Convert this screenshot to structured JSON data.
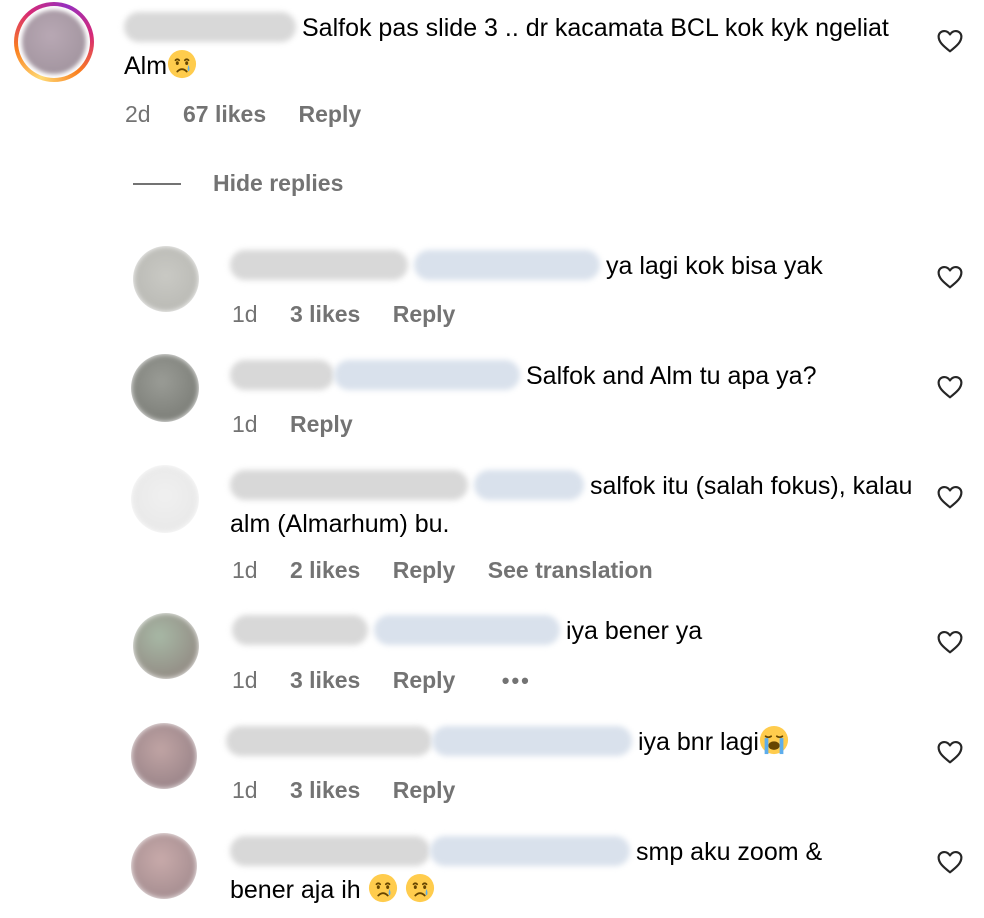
{
  "comments": {
    "main": {
      "text": "Salfok pas slide 3 .. dr kacamata BCL kok kyk ngeliat Alm",
      "time": "2d",
      "likes": "67 likes",
      "reply": "Reply",
      "emoji": "crying-face"
    },
    "hide_replies": "Hide replies",
    "replies": [
      {
        "text": "ya lagi kok bisa yak",
        "time": "1d",
        "likes": "3 likes",
        "reply": "Reply"
      },
      {
        "text": "Salfok and Alm tu apa ya?",
        "time": "1d",
        "reply": "Reply"
      },
      {
        "text": "salfok itu (salah fokus), kalau alm (Almarhum) bu.",
        "time": "1d",
        "likes": "2 likes",
        "reply": "Reply",
        "translation": "See translation"
      },
      {
        "text": "iya bener ya",
        "time": "1d",
        "likes": "3 likes",
        "reply": "Reply",
        "more": "•••"
      },
      {
        "text": "iya bnr lagi",
        "time": "1d",
        "likes": "3 likes",
        "reply": "Reply",
        "emoji": "loudly-crying-face"
      },
      {
        "text": "smp aku zoom & bener aja ih",
        "emoji": "crying-face"
      }
    ]
  },
  "colors": {
    "text": "#000000",
    "meta": "#737373",
    "ring_start": "#feda75",
    "ring_end": "#962fbf"
  }
}
